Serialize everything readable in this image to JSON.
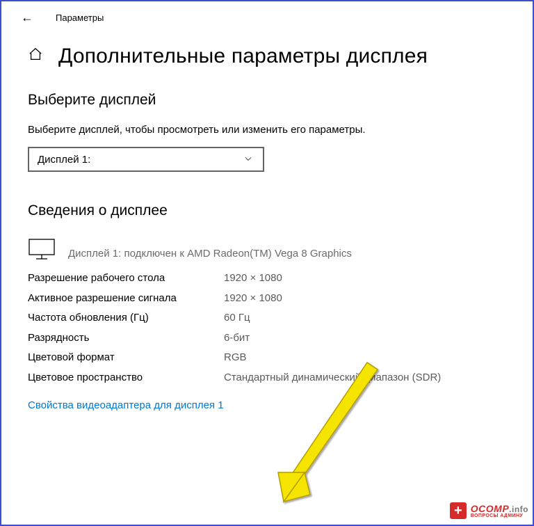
{
  "app_title": "Параметры",
  "page_title": "Дополнительные параметры дисплея",
  "select_display": {
    "heading": "Выберите дисплей",
    "description": "Выберите дисплей, чтобы просмотреть или изменить его параметры.",
    "dropdown_value": "Дисплей 1:"
  },
  "display_info": {
    "heading": "Сведения о дисплее",
    "connection_text": "Дисплей 1: подключен к AMD Radeon(TM) Vega 8 Graphics",
    "rows": [
      {
        "label": "Разрешение рабочего стола",
        "value": "1920 × 1080"
      },
      {
        "label": "Активное разрешение сигнала",
        "value": "1920 × 1080"
      },
      {
        "label": "Частота обновления (Гц)",
        "value": "60 Гц"
      },
      {
        "label": "Разрядность",
        "value": "6-бит"
      },
      {
        "label": "Цветовой формат",
        "value": "RGB"
      },
      {
        "label": "Цветовое пространство",
        "value": "Стандартный динамический диапазон (SDR)"
      }
    ],
    "adapter_link": "Свойства видеоадаптера для дисплея 1"
  },
  "watermark": {
    "site": "OCOMP",
    "tld": ".info",
    "tagline": "ВОПРОСЫ АДМИНУ"
  }
}
